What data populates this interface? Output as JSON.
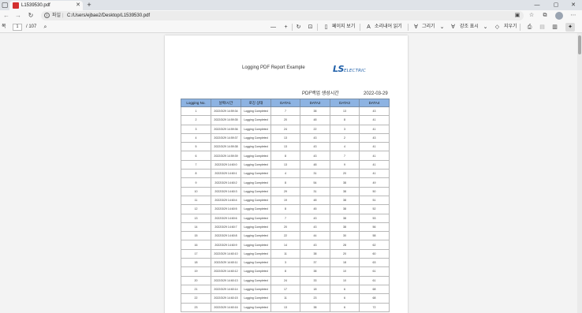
{
  "browser": {
    "tab": {
      "title": "L1539530.pdf"
    },
    "address": {
      "scheme_label": "파일",
      "url": "C:/Users/ejbae2/Desktop/L1539530.pdf"
    }
  },
  "pdf_toolbar": {
    "toc_label": "목",
    "page_current": "1",
    "page_total": "/ 107",
    "zoom_out": "—",
    "zoom_in": "+",
    "page_view_label": "페이지 보기",
    "read_aloud_label": "소리내어 읽기",
    "draw_label": "그리기",
    "highlight_label": "강조 표시",
    "erase_label": "지우기"
  },
  "document": {
    "report_title": "Logging PDF Report Example",
    "logo": {
      "main": "LS",
      "sub": "ELECTRIC"
    },
    "created_label": "PDF백업 생성시간",
    "created_date": "2022-03-29",
    "table": {
      "headers": [
        "Logging No.",
        "날짜/시간",
        "로깅 상태",
        "DATA1",
        "DATA2",
        "DATA3",
        "DATA4"
      ],
      "rows": [
        [
          "1",
          "2022/3/29 14:59:34",
          "Logging Completed",
          "7",
          "38",
          "13",
          "43"
        ],
        [
          "2",
          "2022/3/29 14:59:35",
          "Logging Completed",
          "20",
          "48",
          "8",
          "41"
        ],
        [
          "3",
          "2022/3/29 14:59:36",
          "Logging Completed",
          "24",
          "22",
          "3",
          "41"
        ],
        [
          "4",
          "2022/3/29 14:59:37",
          "Logging Completed",
          "13",
          "43",
          "2",
          "43"
        ],
        [
          "5",
          "2022/3/29 14:59:38",
          "Logging Completed",
          "13",
          "43",
          "4",
          "41"
        ],
        [
          "6",
          "2022/3/29 14:59:39",
          "Logging Completed",
          "8",
          "43",
          "7",
          "41"
        ],
        [
          "7",
          "2022/3/29 14:60:0",
          "Logging Completed",
          "13",
          "48",
          "9",
          "41"
        ],
        [
          "8",
          "2022/3/29 14:60:1",
          "Logging Completed",
          "4",
          "31",
          "20",
          "41"
        ],
        [
          "9",
          "2022/3/29 14:60:2",
          "Logging Completed",
          "8",
          "54",
          "38",
          "49"
        ],
        [
          "10",
          "2022/3/29 14:60:3",
          "Logging Completed",
          "29",
          "31",
          "38",
          "50"
        ],
        [
          "11",
          "2022/3/29 14:60:4",
          "Logging Completed",
          "19",
          "48",
          "38",
          "51"
        ],
        [
          "12",
          "2022/3/29 14:60:5",
          "Logging Completed",
          "8",
          "45",
          "38",
          "52"
        ],
        [
          "13",
          "2022/3/29 14:60:6",
          "Logging Completed",
          "7",
          "43",
          "38",
          "53"
        ],
        [
          "14",
          "2022/3/29 14:60:7",
          "Logging Completed",
          "20",
          "43",
          "38",
          "56"
        ],
        [
          "15",
          "2022/3/29 14:60:8",
          "Logging Completed",
          "22",
          "44",
          "30",
          "58"
        ],
        [
          "16",
          "2022/3/29 14:60:9",
          "Logging Completed",
          "14",
          "43",
          "28",
          "62"
        ],
        [
          "17",
          "2022/3/29 14:60:10",
          "Logging Completed",
          "11",
          "38",
          "20",
          "60"
        ],
        [
          "18",
          "2022/3/29 14:60:11",
          "Logging Completed",
          "3",
          "37",
          "18",
          "63"
        ],
        [
          "19",
          "2022/3/29 14:60:12",
          "Logging Completed",
          "8",
          "38",
          "10",
          "61"
        ],
        [
          "20",
          "2022/3/29 14:60:13",
          "Logging Completed",
          "24",
          "33",
          "10",
          "61"
        ],
        [
          "21",
          "2022/3/29 14:60:14",
          "Logging Completed",
          "17",
          "18",
          "6",
          "68"
        ],
        [
          "22",
          "2022/3/29 14:60:15",
          "Logging Completed",
          "11",
          "23",
          "6",
          "68"
        ],
        [
          "23",
          "2022/3/29 14:60:16",
          "Logging Completed",
          "13",
          "38",
          "6",
          "72"
        ]
      ]
    }
  },
  "colors": {
    "table_header_bg": "#8db3e2",
    "logo_blue": "#1f5fa8"
  }
}
